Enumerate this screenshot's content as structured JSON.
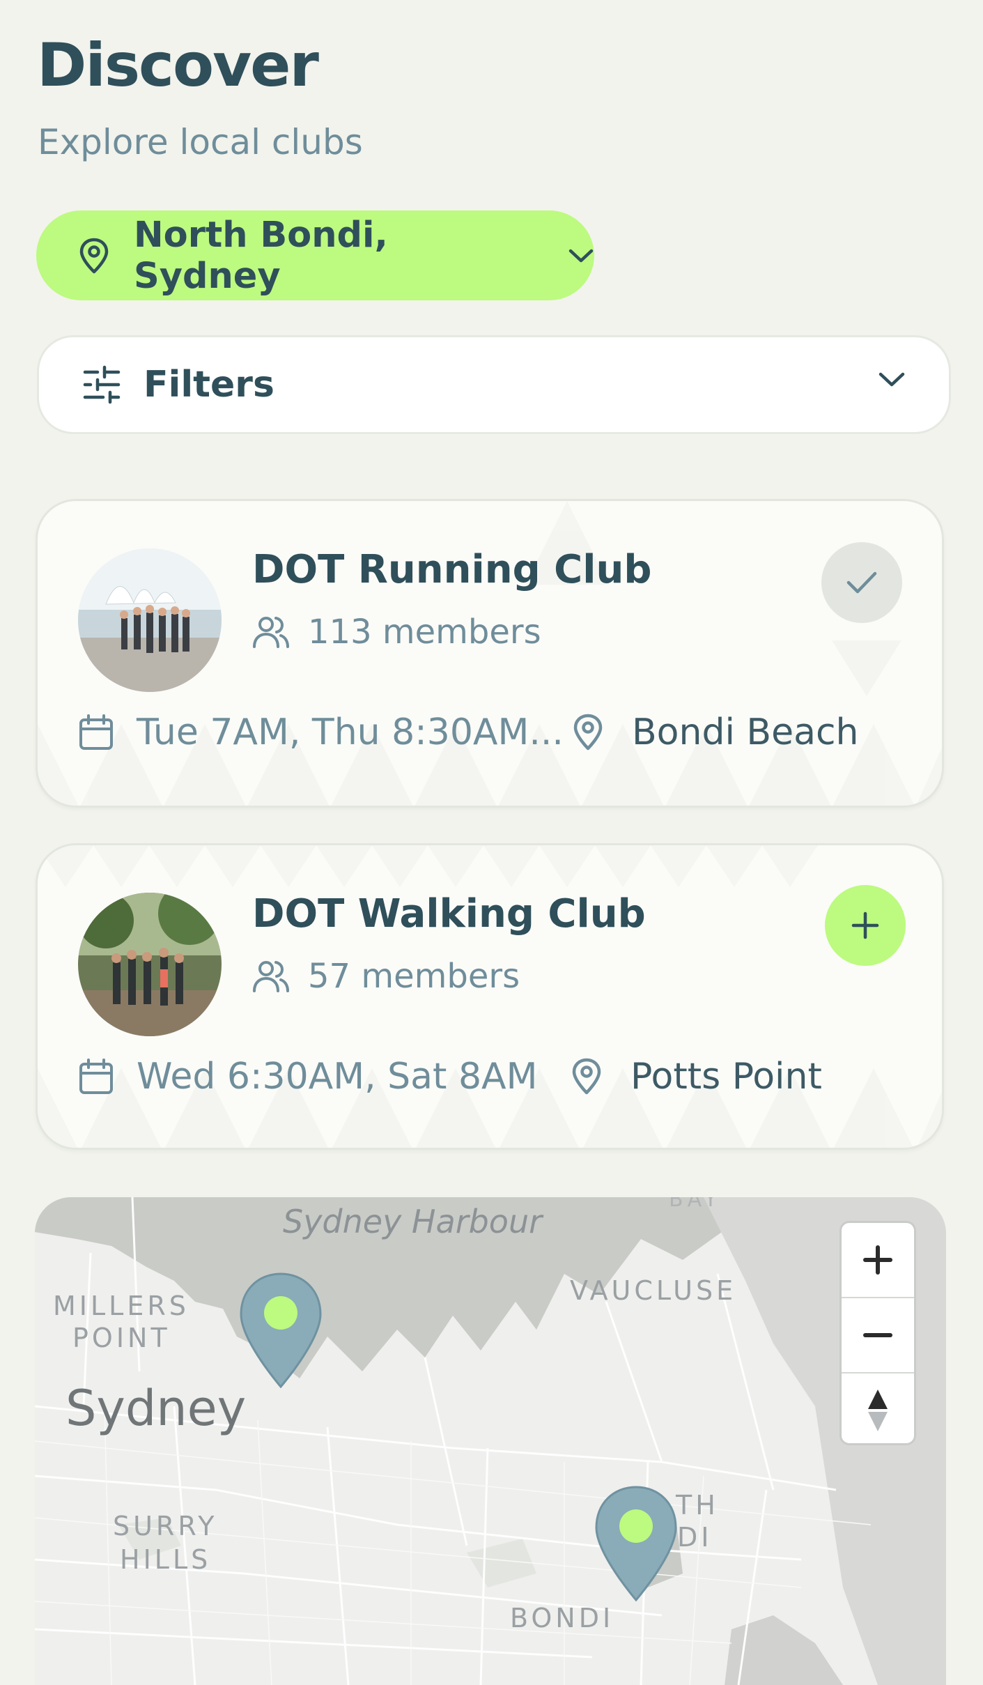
{
  "header": {
    "title": "Discover",
    "subtitle": "Explore local clubs"
  },
  "location": {
    "label": "North Bondi, Sydney"
  },
  "filters": {
    "label": "Filters"
  },
  "clubs": [
    {
      "name": "DOT Running Club",
      "members": "113 members",
      "schedule": "Tue 7AM, Thu 8:30AM...",
      "place": "Bondi Beach",
      "status": "joined"
    },
    {
      "name": "DOT Walking Club",
      "members": "57 members",
      "schedule": "Wed 6:30AM, Sat 8AM",
      "place": "Potts Point",
      "status": "not-joined"
    }
  ],
  "map": {
    "labels": {
      "harbour": "Sydney Harbour",
      "millers_1": "MILLERS",
      "millers_2": "POINT",
      "vaucluse": "VAUCLUSE",
      "sydney": "Sydney",
      "surry_1": "SURRY",
      "surry_2": "HILLS",
      "bondi": "BONDI",
      "th": "TH",
      "di": "DI",
      "bay": "BAY"
    }
  },
  "colors": {
    "accent": "#bdfa80",
    "text_primary": "#2f4f5a",
    "text_secondary": "#6f8d9a",
    "pin": "#8aabb8",
    "background": "#f2f3ed"
  }
}
